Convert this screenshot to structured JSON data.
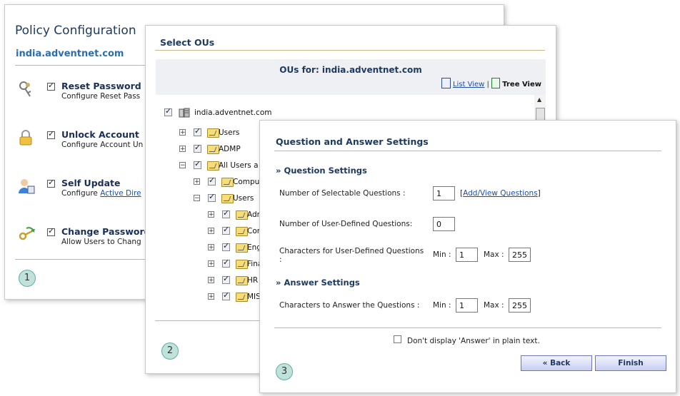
{
  "policy": {
    "title": "Policy Configuration",
    "domain": "india.adventnet.com",
    "items": [
      {
        "title": "Reset Password",
        "desc": "Configure Reset Pass",
        "link": "",
        "icon": "keys-icon"
      },
      {
        "title": "Unlock Account",
        "desc": "Configure Account Un",
        "link": "",
        "icon": "padlock-icon"
      },
      {
        "title": "Self Update",
        "desc": "Configure ",
        "link": "Active Dire",
        "icon": "user-icon"
      },
      {
        "title": "Change Password",
        "desc": "Allow Users to Chang",
        "link": "",
        "icon": "key-arrow-icon"
      }
    ],
    "step": "1"
  },
  "ous": {
    "title": "Select OUs",
    "header": "OUs for: india.adventnet.com",
    "list_view": "List View",
    "separator": "|",
    "tree_view": "Tree View",
    "tree": [
      {
        "label": "india.adventnet.com"
      },
      {
        "label": "Users"
      },
      {
        "label": "ADMP"
      },
      {
        "label": "All Users a"
      },
      {
        "label": "Comput"
      },
      {
        "label": "Users"
      },
      {
        "label": "Adm"
      },
      {
        "label": "Con"
      },
      {
        "label": "Eng"
      },
      {
        "label": "Fina"
      },
      {
        "label": "HR"
      },
      {
        "label": "MIS"
      }
    ],
    "step": "2"
  },
  "qa": {
    "title": "Question and Answer Settings",
    "question_section": "Question Settings",
    "selectable_label": "Number of Selectable Questions :",
    "selectable_value": "1",
    "add_view_link": "Add/View Questions",
    "bracket_open": "[",
    "bracket_close": "]",
    "user_defined_label": "Number of User-Defined Questions:",
    "user_defined_value": "0",
    "chars_user_label_1": "Characters for User-Defined Questions",
    "chars_user_label_2": ":",
    "min_label": "Min :",
    "max_label": "Max :",
    "user_min": "1",
    "user_max": "255",
    "answer_section": "Answer Settings",
    "chars_answer_label": "Characters to Answer the Questions :",
    "answer_min": "1",
    "answer_max": "255",
    "plain_text_label": "Don't display 'Answer' in plain text.",
    "back_button": "« Back",
    "finish_button": "Finish",
    "step": "3"
  }
}
